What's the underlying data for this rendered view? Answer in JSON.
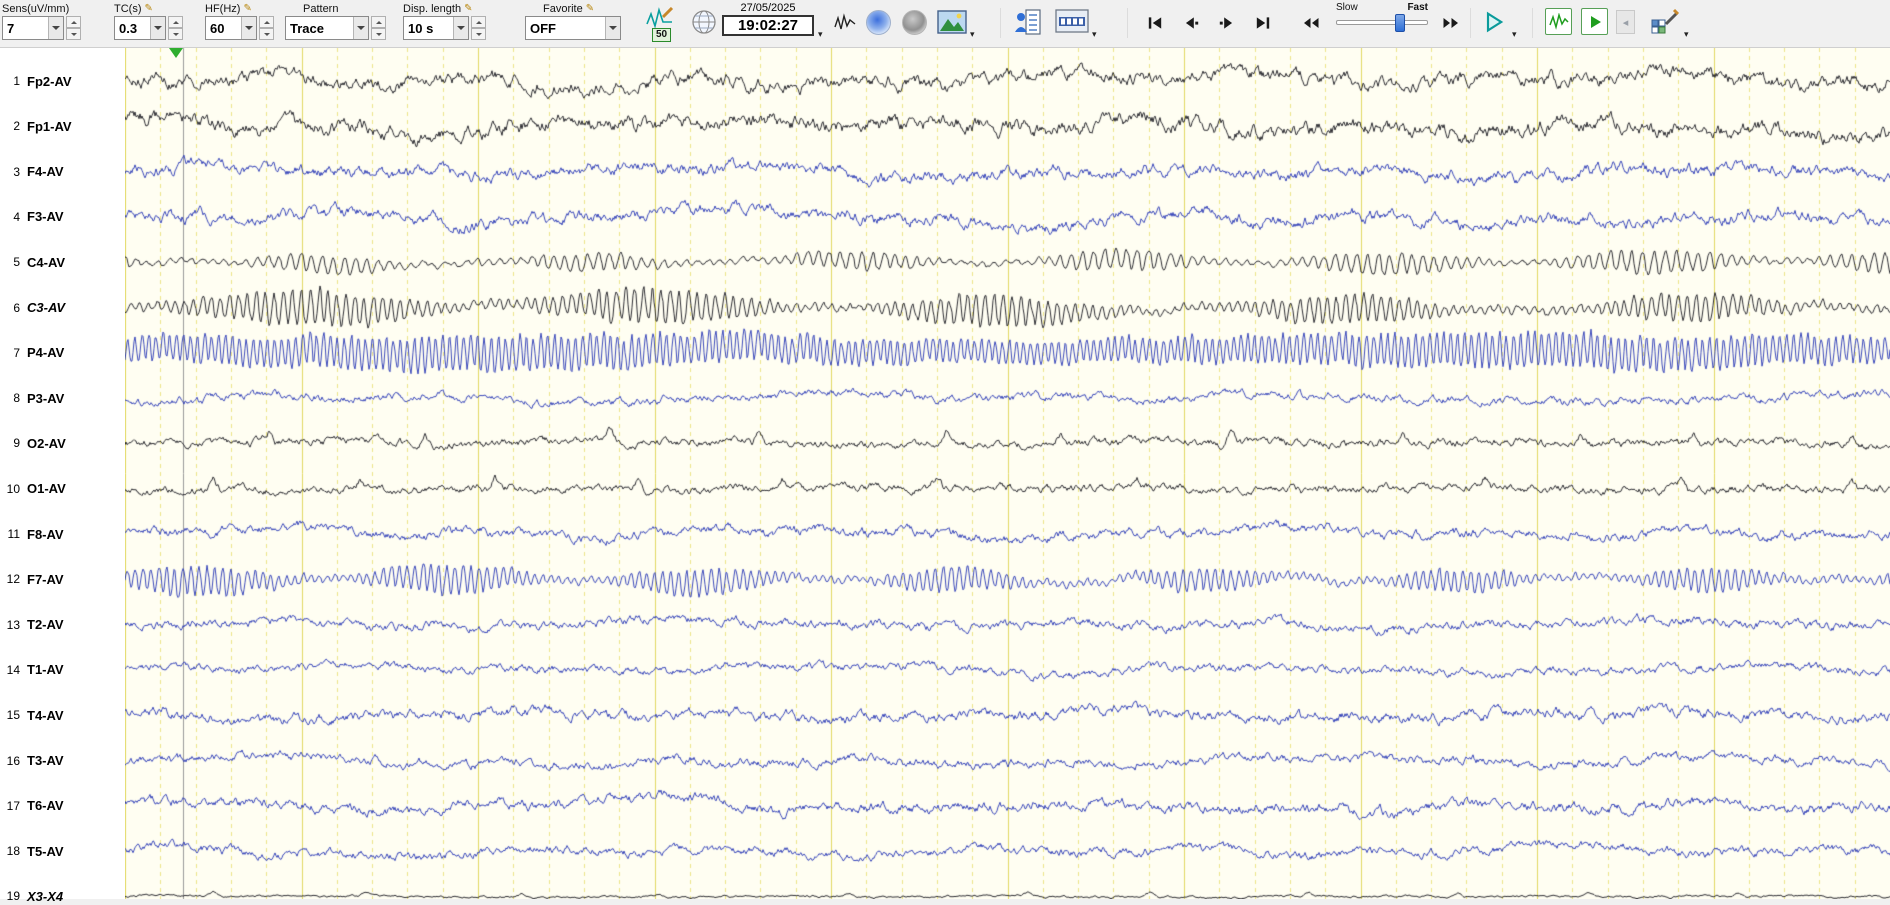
{
  "colors": {
    "black_trace": "#15151d",
    "blue_trace": "#2433b4",
    "bg": "#fffef2",
    "grid_major": "#e2d964",
    "grid_minor": "#ede588",
    "cursor": "#9a9a9a",
    "accent_green": "#1f9d1f",
    "accent_teal": "#0a9b9b"
  },
  "icons": {
    "pencil": "✎",
    "dropdown_arrow": "▾",
    "back_glyph": "◂"
  },
  "toolbar": {
    "sens": {
      "label": "Sens(uV/mm)",
      "value": "7"
    },
    "tc": {
      "label": "TC(s)",
      "value": "0.3"
    },
    "hf": {
      "label": "HF(Hz)",
      "value": "60"
    },
    "pattern": {
      "label": "Pattern",
      "value": "Trace"
    },
    "disp_length": {
      "label": "Disp. length",
      "value": "10 s"
    },
    "favorite": {
      "label": "Favorite",
      "value": "OFF"
    },
    "notch_badge": "50",
    "date": "27/05/2025",
    "time": "19:02:27",
    "slow": "Slow",
    "fast": "Fast"
  },
  "display": {
    "seconds": 10,
    "minor_per_second": 5,
    "cursor_x_frac": 0.0329
  },
  "channels": [
    {
      "num": "1",
      "label": "Fp2-AV",
      "color": "black",
      "italic": false,
      "wave": {
        "type": "mixed",
        "amp": 9
      }
    },
    {
      "num": "2",
      "label": "Fp1-AV",
      "color": "black",
      "italic": false,
      "wave": {
        "type": "mixed",
        "amp": 10
      }
    },
    {
      "num": "3",
      "label": "F4-AV",
      "color": "blue",
      "italic": false,
      "wave": {
        "type": "mixed",
        "amp": 8
      }
    },
    {
      "num": "4",
      "label": "F3-AV",
      "color": "blue",
      "italic": false,
      "wave": {
        "type": "mixed",
        "amp": 8
      }
    },
    {
      "num": "5",
      "label": "C4-AV",
      "color": "black",
      "italic": false,
      "wave": {
        "type": "dense",
        "amp": 10,
        "period": 11
      }
    },
    {
      "num": "6",
      "label": "C3-AV",
      "color": "black",
      "italic": true,
      "wave": {
        "type": "dense",
        "amp": 15,
        "period": 9
      }
    },
    {
      "num": "7",
      "label": "P4-AV",
      "color": "blue",
      "italic": false,
      "wave": {
        "type": "dense",
        "amp": 17,
        "period": 7,
        "modflat": true
      }
    },
    {
      "num": "8",
      "label": "P3-AV",
      "color": "blue",
      "italic": false,
      "wave": {
        "type": "mixed",
        "amp": 5.5
      }
    },
    {
      "num": "9",
      "label": "O2-AV",
      "color": "black",
      "italic": false,
      "wave": {
        "type": "spiky",
        "amp": 5.5,
        "spike": 11,
        "per": 150
      }
    },
    {
      "num": "10",
      "label": "O1-AV",
      "color": "black",
      "italic": false,
      "wave": {
        "type": "spiky",
        "amp": 5.5,
        "spike": 10,
        "per": 170
      }
    },
    {
      "num": "11",
      "label": "F8-AV",
      "color": "blue",
      "italic": false,
      "wave": {
        "type": "mixed",
        "amp": 6.5
      }
    },
    {
      "num": "12",
      "label": "F7-AV",
      "color": "blue",
      "italic": false,
      "wave": {
        "type": "dense",
        "amp": 13,
        "period": 8
      }
    },
    {
      "num": "13",
      "label": "T2-AV",
      "color": "blue",
      "italic": false,
      "wave": {
        "type": "mixed",
        "amp": 6
      }
    },
    {
      "num": "14",
      "label": "T1-AV",
      "color": "blue",
      "italic": false,
      "wave": {
        "type": "mixed",
        "amp": 5.5
      }
    },
    {
      "num": "15",
      "label": "T4-AV",
      "color": "blue",
      "italic": false,
      "wave": {
        "type": "mixed",
        "amp": 7
      }
    },
    {
      "num": "16",
      "label": "T3-AV",
      "color": "blue",
      "italic": false,
      "wave": {
        "type": "mixed",
        "amp": 6
      }
    },
    {
      "num": "17",
      "label": "T6-AV",
      "color": "blue",
      "italic": false,
      "wave": {
        "type": "mixed",
        "amp": 7
      }
    },
    {
      "num": "18",
      "label": "T5-AV",
      "color": "blue",
      "italic": false,
      "wave": {
        "type": "mixed",
        "amp": 6
      }
    },
    {
      "num": "19",
      "label": "X3-X4",
      "color": "black",
      "italic": true,
      "wave": {
        "type": "flat",
        "amp": 1.6,
        "spike": 4,
        "per": 160
      }
    }
  ]
}
